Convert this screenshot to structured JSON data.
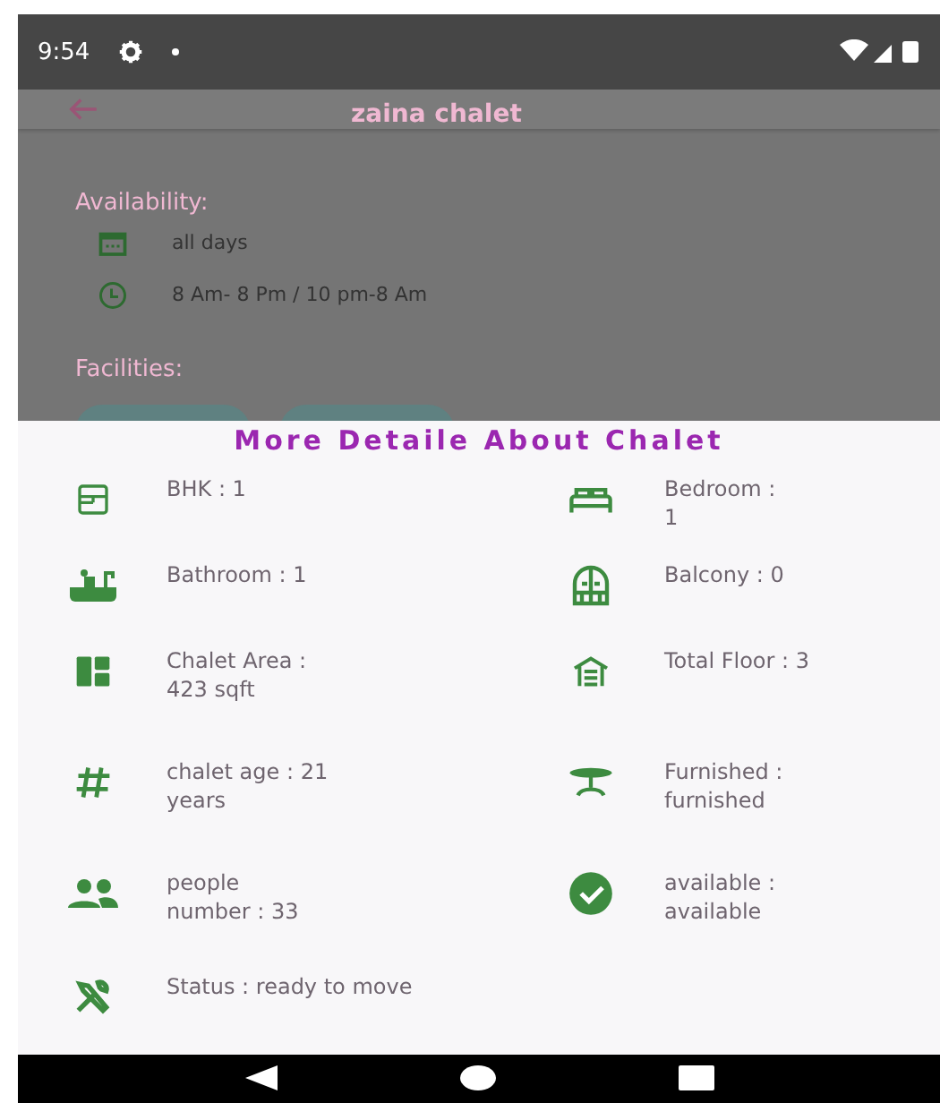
{
  "status_bar": {
    "time": "9:54"
  },
  "app_bar": {
    "title": "zaina chalet"
  },
  "availability": {
    "heading": "Availability:",
    "items": [
      {
        "kind": "calendar",
        "text": "all days"
      },
      {
        "kind": "clock",
        "text": "8 Am- 8 Pm / 10 pm-8 Am"
      }
    ]
  },
  "facilities": {
    "heading": "Facilities:"
  },
  "details_sheet": {
    "title": "More Detaile About Chalet",
    "items": [
      {
        "kind": "bhk",
        "text": "BHK : 1"
      },
      {
        "kind": "bed",
        "text": "Bedroom :\n1"
      },
      {
        "kind": "bath",
        "text": "Bathroom : 1"
      },
      {
        "kind": "balcony",
        "text": "Balcony : 0"
      },
      {
        "kind": "area",
        "text": "Chalet Area :\n423 sqft"
      },
      {
        "kind": "floor",
        "text": "Total Floor : 3"
      },
      {
        "kind": "age",
        "text": "chalet age : 21\nyears"
      },
      {
        "kind": "furnished",
        "text": "Furnished :\nfurnished"
      },
      {
        "kind": "people",
        "text": "people\nnumber : 33"
      },
      {
        "kind": "available",
        "text": "available :\navailable"
      }
    ],
    "status": {
      "kind": "tools",
      "text": "Status : ready to move"
    }
  }
}
